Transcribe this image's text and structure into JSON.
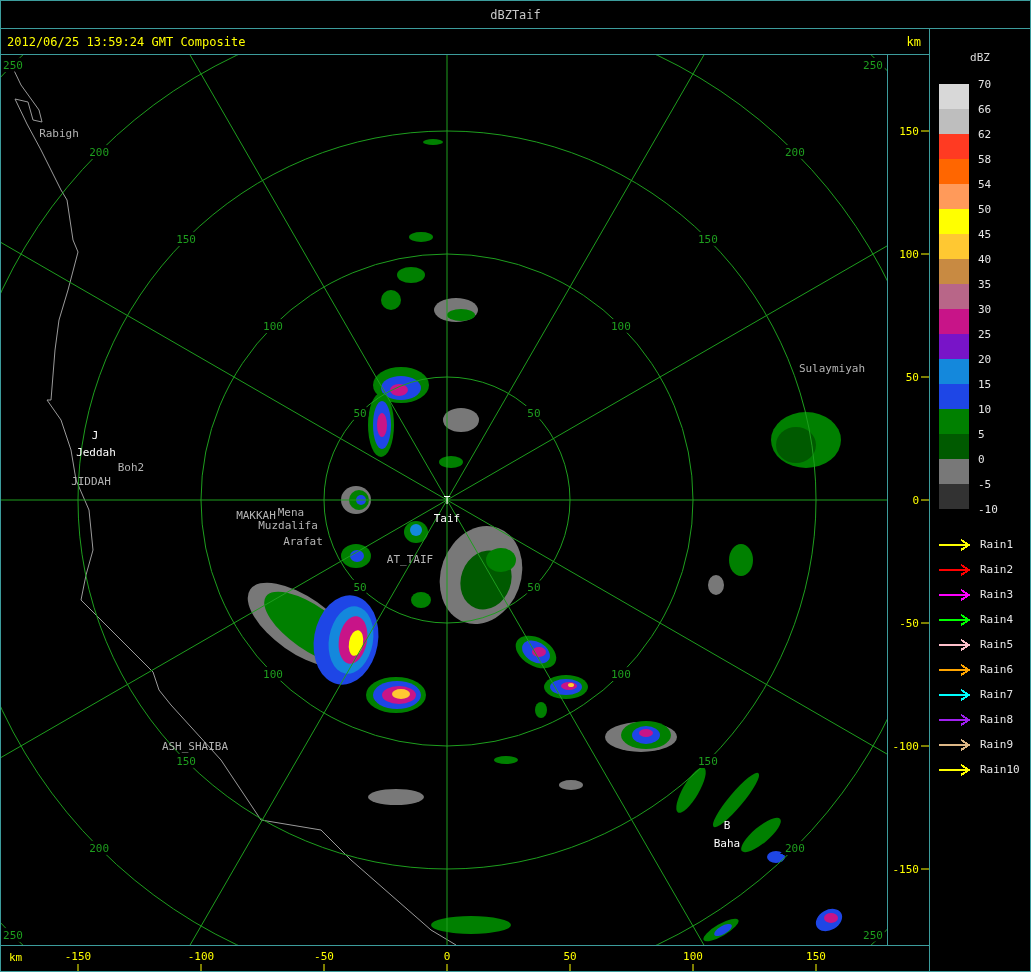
{
  "window": {
    "title": "dBZTaif"
  },
  "header": {
    "timestamp": "2012/06/25 13:59:24 GMT Composite",
    "unit": "km"
  },
  "plot": {
    "range_labels": [
      [
        "50",
        "100",
        "150",
        "200",
        "250"
      ],
      [
        "50",
        "100",
        "150",
        "200",
        "250"
      ],
      [
        "50",
        "100",
        "150",
        "200",
        "250"
      ],
      [
        "50",
        "100",
        "150",
        "200",
        "250"
      ]
    ],
    "places": [
      {
        "name": "Rabigh",
        "kind": "place"
      },
      {
        "name": "J",
        "kind": "marker"
      },
      {
        "name": "Jeddah",
        "kind": "site"
      },
      {
        "name": "Boh2",
        "kind": "place"
      },
      {
        "name": "JIDDAH",
        "kind": "place"
      },
      {
        "name": "MAKKAH",
        "kind": "place"
      },
      {
        "name": "Mena",
        "kind": "place"
      },
      {
        "name": "Muzdalifa",
        "kind": "place"
      },
      {
        "name": "Arafat",
        "kind": "place"
      },
      {
        "name": "AT_TAIF",
        "kind": "place"
      },
      {
        "name": "T",
        "kind": "marker"
      },
      {
        "name": "Taif",
        "kind": "site"
      },
      {
        "name": "Sulaymiyah",
        "kind": "place"
      },
      {
        "name": "ASH_SHAIBA",
        "kind": "place"
      },
      {
        "name": "B",
        "kind": "marker"
      },
      {
        "name": "Baha",
        "kind": "site"
      }
    ],
    "y_axis": {
      "ticks": [
        "150",
        "100",
        "50",
        "0",
        "-50",
        "-100",
        "-150"
      ]
    },
    "x_axis": {
      "unit": "km",
      "ticks": [
        "-150",
        "-100",
        "-50",
        "0",
        "50",
        "100",
        "150"
      ]
    }
  },
  "legend": {
    "title": "dBZ",
    "labels": [
      "70",
      "66",
      "62",
      "58",
      "54",
      "50",
      "45",
      "40",
      "35",
      "30",
      "25",
      "20",
      "15",
      "10",
      "5",
      "0",
      "-5",
      "-10"
    ],
    "bins": [
      {
        "color": "#d8d8d8"
      },
      {
        "color": "#bebebe"
      },
      {
        "color": "#ff3a22"
      },
      {
        "color": "#ff6600"
      },
      {
        "color": "#ff9a5a"
      },
      {
        "color": "#ffff00"
      },
      {
        "color": "#ffc832"
      },
      {
        "color": "#c88a42"
      },
      {
        "color": "#b86688"
      },
      {
        "color": "#c81488"
      },
      {
        "color": "#7814c8"
      },
      {
        "color": "#1488dc"
      },
      {
        "color": "#1e46e6"
      },
      {
        "color": "#008000"
      },
      {
        "color": "#005a00"
      },
      {
        "color": "#787878"
      },
      {
        "color": "#323232"
      }
    ],
    "tracks": [
      {
        "name": "Rain1",
        "color": "#ffff00"
      },
      {
        "name": "Rain2",
        "color": "#ff0000"
      },
      {
        "name": "Rain3",
        "color": "#ff00ff"
      },
      {
        "name": "Rain4",
        "color": "#00ff00"
      },
      {
        "name": "Rain5",
        "color": "#ffc0cb"
      },
      {
        "name": "Rain6",
        "color": "#ffa500"
      },
      {
        "name": "Rain7",
        "color": "#00ffff"
      },
      {
        "name": "Rain8",
        "color": "#a020f0"
      },
      {
        "name": "Rain9",
        "color": "#deb887"
      },
      {
        "name": "Rain10",
        "color": "#ffff00"
      }
    ]
  }
}
